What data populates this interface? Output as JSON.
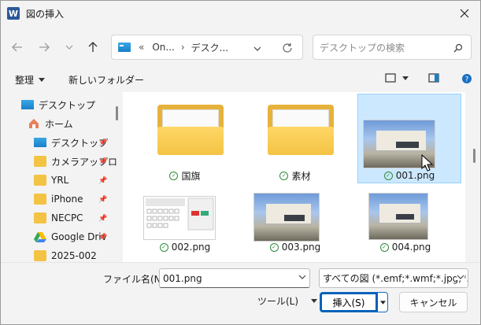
{
  "window": {
    "title": "図の挿入",
    "app_icon": "W"
  },
  "address": {
    "chevrons": "«",
    "path": [
      "On...",
      "デスク..."
    ],
    "search_placeholder": "デスクトップの検索"
  },
  "toolbar": {
    "organize": "整理",
    "new_folder": "新しいフォルダー"
  },
  "sidebar": {
    "items": [
      {
        "label": "デスクトップ",
        "icon": "desktop-icon"
      },
      {
        "label": "ホーム",
        "icon": "home-icon"
      },
      {
        "label": "デスクトップ",
        "icon": "desktop-icon",
        "pinned": true
      },
      {
        "label": "カメラアップロ",
        "icon": "folder-icon",
        "pinned": true
      },
      {
        "label": "YRL",
        "icon": "folder-icon",
        "pinned": true
      },
      {
        "label": "iPhone",
        "icon": "folder-icon",
        "pinned": true
      },
      {
        "label": "NECPC",
        "icon": "folder-icon",
        "pinned": true
      },
      {
        "label": "Google Driv",
        "icon": "google-drive-icon",
        "pinned": true
      },
      {
        "label": "2025-002",
        "icon": "folder-icon"
      }
    ]
  },
  "files": [
    {
      "name": "国旗",
      "type": "folder"
    },
    {
      "name": "素材",
      "type": "folder"
    },
    {
      "name": "001.png",
      "type": "image",
      "selected": true
    },
    {
      "name": "002.png",
      "type": "image"
    },
    {
      "name": "003.png",
      "type": "image"
    },
    {
      "name": "004.png",
      "type": "image"
    }
  ],
  "bottom": {
    "filename_label": "ファイル名(N):",
    "filename_value": "001.png",
    "filetype_value": "すべての図 (*.emf;*.wmf;*.jpg;*.jp",
    "tools_label": "ツール(L)",
    "insert_label": "挿入(S)",
    "cancel_label": "キャンセル"
  },
  "colors": {
    "accent": "#005fb8",
    "selected_bg": "#cce8ff",
    "folder": "#f3c344"
  }
}
